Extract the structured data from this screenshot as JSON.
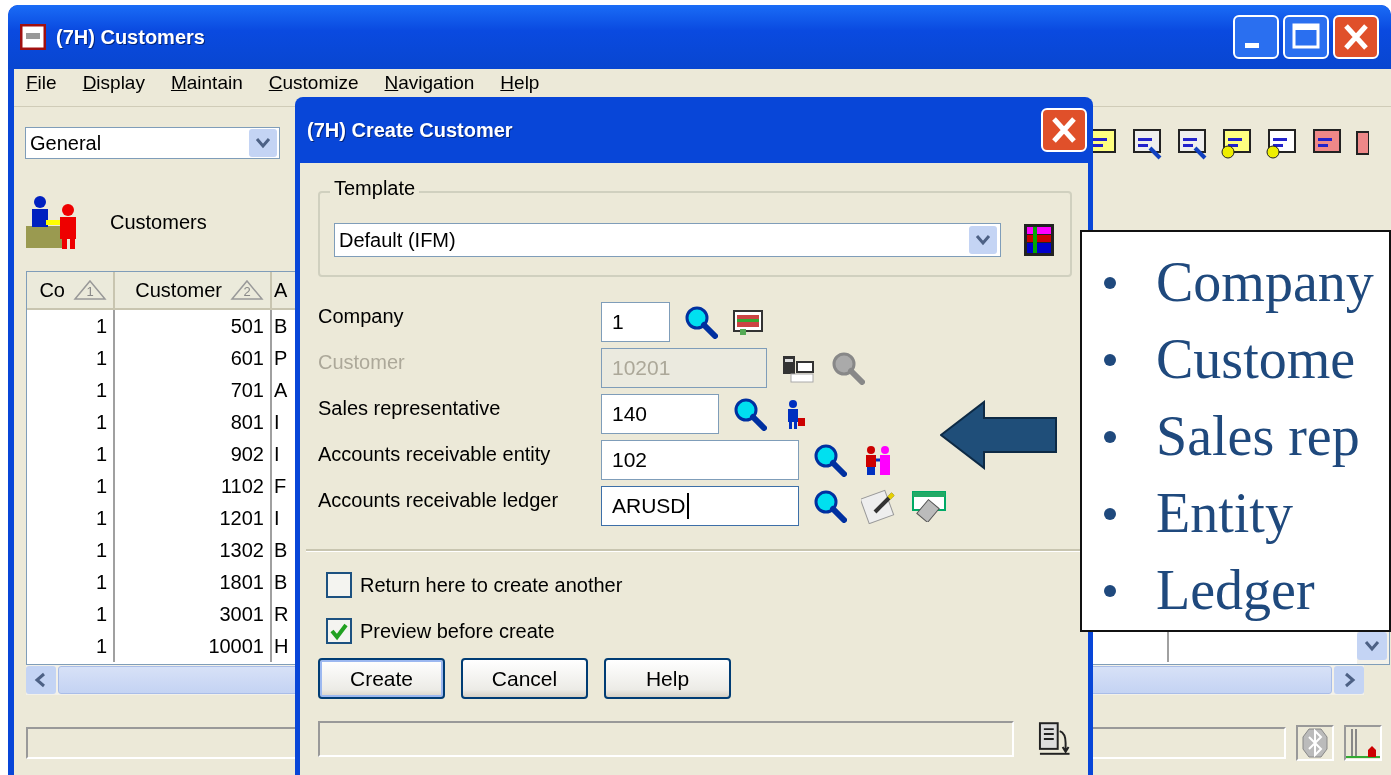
{
  "window": {
    "title": "(7H) Customers"
  },
  "menu": [
    {
      "label": "File"
    },
    {
      "label": "Display"
    },
    {
      "label": "Maintain"
    },
    {
      "label": "Customize"
    },
    {
      "label": "Navigation"
    },
    {
      "label": "Help"
    }
  ],
  "view_select": {
    "value": "General"
  },
  "page_heading": "Customers",
  "table": {
    "columns": [
      {
        "label": "Co",
        "sort": "1"
      },
      {
        "label": "Customer",
        "sort": "2"
      },
      {
        "label": "A"
      }
    ],
    "rows": [
      [
        "1",
        "501",
        "B"
      ],
      [
        "1",
        "601",
        "P"
      ],
      [
        "1",
        "701",
        "A"
      ],
      [
        "1",
        "801",
        "I"
      ],
      [
        "1",
        "902",
        "I"
      ],
      [
        "1",
        "1102",
        "F"
      ],
      [
        "1",
        "1201",
        "I"
      ],
      [
        "1",
        "1302",
        "B"
      ],
      [
        "1",
        "1801",
        "B"
      ],
      [
        "1",
        "3001",
        "R"
      ],
      [
        "1",
        "10001",
        "H"
      ]
    ]
  },
  "dialog": {
    "title": "(7H) Create Customer",
    "template": {
      "legend": "Template",
      "value": "Default (IFM)"
    },
    "fields": [
      {
        "label": "Company",
        "value": "1",
        "disabled": false,
        "focused": false
      },
      {
        "label": "Customer",
        "value": "10201",
        "disabled": true,
        "focused": false
      },
      {
        "label": "Sales representative",
        "value": "140",
        "disabled": false,
        "focused": false
      },
      {
        "label": "Accounts receivable entity",
        "value": "102",
        "disabled": false,
        "focused": false
      },
      {
        "label": "Accounts receivable ledger",
        "value": "ARUSD",
        "disabled": false,
        "focused": true
      }
    ],
    "checkboxes": [
      {
        "label": "Return here to create another",
        "checked": false
      },
      {
        "label": "Preview before create",
        "checked": true
      }
    ],
    "buttons": [
      {
        "label": "Create",
        "default": true
      },
      {
        "label": "Cancel",
        "default": false
      },
      {
        "label": "Help",
        "default": false
      }
    ]
  },
  "callout": {
    "items": [
      "Company",
      "Custome",
      "Sales rep",
      "Entity",
      "Ledger"
    ]
  }
}
